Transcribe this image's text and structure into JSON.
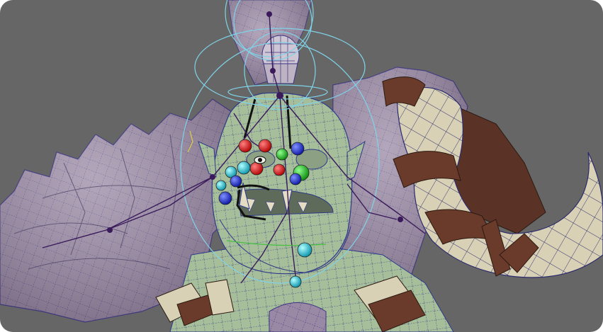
{
  "viewport": {
    "background": "#666666",
    "scene": "3d-character-rig-wireframe"
  },
  "palette": {
    "fur": "#9c8aa5",
    "fur_dark": "#6f5f7a",
    "skin": "#a9bf9c",
    "skin_dark": "#7f9978",
    "horn": "#d8d0b4",
    "strap": "#6a3a2a",
    "wire": "#2a2a8a",
    "ring": "#7fd3e8",
    "control_red": "#e02020",
    "control_green": "#20c020",
    "control_blue": "#2030e0",
    "control_cyan": "#20c8e0",
    "skeleton": "#3a1a5a"
  },
  "controls": [
    {
      "name": "brow-control-left-outer",
      "color": "red"
    },
    {
      "name": "brow-control-left-inner",
      "color": "red"
    },
    {
      "name": "brow-control-center",
      "color": "green"
    },
    {
      "name": "brow-control-right",
      "color": "blue"
    },
    {
      "name": "eye-control-left",
      "color": "red"
    },
    {
      "name": "eye-control-right",
      "color": "red"
    },
    {
      "name": "eye-control-right-target",
      "color": "green"
    },
    {
      "name": "cheek-control-left",
      "color": "cyan"
    },
    {
      "name": "cheek-control-left-2",
      "color": "cyan"
    },
    {
      "name": "cheek-control-left-3",
      "color": "blue"
    },
    {
      "name": "nose-control",
      "color": "blue"
    },
    {
      "name": "jaw-control",
      "color": "cyan"
    },
    {
      "name": "neck-control",
      "color": "cyan"
    },
    {
      "name": "lip-control-left",
      "color": "blue"
    },
    {
      "name": "lip-control-left-2",
      "color": "cyan"
    }
  ]
}
